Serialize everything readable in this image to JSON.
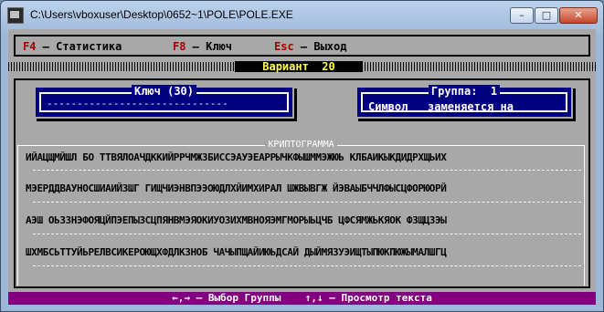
{
  "window": {
    "title": "C:\\Users\\vboxuser\\Desktop\\0652~1\\POLE\\POLE.EXE",
    "minimize_glyph": "–",
    "maximize_glyph": "□",
    "close_glyph": "✕"
  },
  "menu": [
    {
      "key": "F4",
      "label": " – Статистика"
    },
    {
      "key": "F8",
      "label": " – Ключ"
    },
    {
      "key": "Esc",
      "label": " – Выход"
    }
  ],
  "variant": "Вариант  20",
  "key_panel": {
    "title": "Ключ (30)",
    "value": "------------------------------"
  },
  "group_panel": {
    "title": "Группа:  1",
    "symbol_label": "Символ",
    "replaced_label": "заменяется на"
  },
  "cryptogram": {
    "title": "КРИПТОГРАММА",
    "lines": [
      "ИЙАЦЩМЙШЛ БО ТТВЯЛОАЧДККИЙРРЧМЖЗБИССЭАУЭЕАРРЫЧКФЫШММЭЖЮЬ КЛБАИКЫКДИДРХЩЬИХ",
      "МЭЕРДДВАУНОСШИАИЙЗШГ ГИЩЧИЭНВПЭЭОЮДЛХЙИМХИРАЛ ШЖВЫВГЖ ЙЭВАЫБЧЧЛФЫСЦФОРЮОРЙ",
      "АЭШ ОЬЗЗНЭФОЯЦЙПЭЕПЫЗСЦПЯНВМЭЯОКИУОЗИХМВНОЯЭМГМОРЫЬЦЧБ ЦФСЯМЖЬКЯОК ФЗЩЦЗЭЫ",
      "ШХМБСЬТТУЙЬРЕЛВСИКЕРОЮЩХФДЛКЗНОБ ЧАЧЫПЩАЙИЮЬДСАЙ ДЫЙМЯЗУЭИЩТЫПЮКПЮЖЫМАЛШГЦ"
    ]
  },
  "status": "←,→ – Выбор Группы    ↑,↓ – Просмотр текста",
  "colors": {
    "dos_gray": "#a8a8a8",
    "panel_blue": "#000080",
    "status_magenta": "#800080",
    "menu_key_red": "#a80000",
    "variant_yellow": "#ffff55"
  }
}
